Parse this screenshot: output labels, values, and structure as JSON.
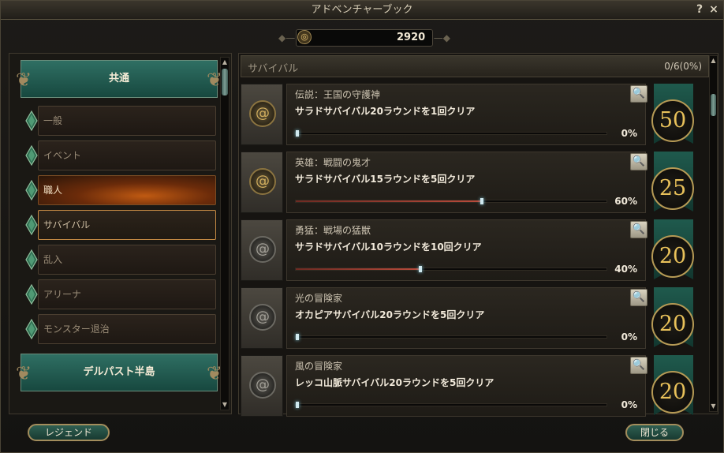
{
  "window": {
    "title": "アドベンチャーブック",
    "help": "?",
    "close": "×"
  },
  "points": {
    "value": "2920",
    "icon": "coin-spiral-icon"
  },
  "sidebar": {
    "category_top": "共通",
    "category_bottom": "デルパスト半島",
    "items": [
      {
        "label": "一般",
        "state": "normal"
      },
      {
        "label": "イベント",
        "state": "normal"
      },
      {
        "label": "職人",
        "state": "active"
      },
      {
        "label": "サバイバル",
        "state": "selected"
      },
      {
        "label": "乱入",
        "state": "normal"
      },
      {
        "label": "アリーナ",
        "state": "normal"
      },
      {
        "label": "モンスター退治",
        "state": "normal"
      }
    ]
  },
  "main": {
    "section_title": "サバイバル",
    "section_progress": "0/6(0%)",
    "achievements": [
      {
        "name": "伝説：王国の守護神",
        "desc": "サラドサバイバル20ラウンドを1回クリア",
        "percent": "0%",
        "progress": 0,
        "points": "50",
        "emblem": "gold"
      },
      {
        "name": "英雄：戦闘の鬼才",
        "desc": "サラドサバイバル15ラウンドを5回クリア",
        "percent": "60%",
        "progress": 0.6,
        "points": "25",
        "emblem": "gold"
      },
      {
        "name": "勇猛：戦場の猛獣",
        "desc": "サラドサバイバル10ラウンドを10回クリア",
        "percent": "40%",
        "progress": 0.4,
        "points": "20",
        "emblem": "grey"
      },
      {
        "name": "光の冒険家",
        "desc": "オカピアサバイバル20ラウンドを5回クリア",
        "percent": "0%",
        "progress": 0,
        "points": "20",
        "emblem": "grey"
      },
      {
        "name": "風の冒険家",
        "desc": "レッコ山脈サバイバル20ラウンドを5回クリア",
        "percent": "0%",
        "progress": 0,
        "points": "20",
        "emblem": "grey"
      }
    ]
  },
  "buttons": {
    "legend": "レジェンド",
    "close": "閉じる"
  }
}
